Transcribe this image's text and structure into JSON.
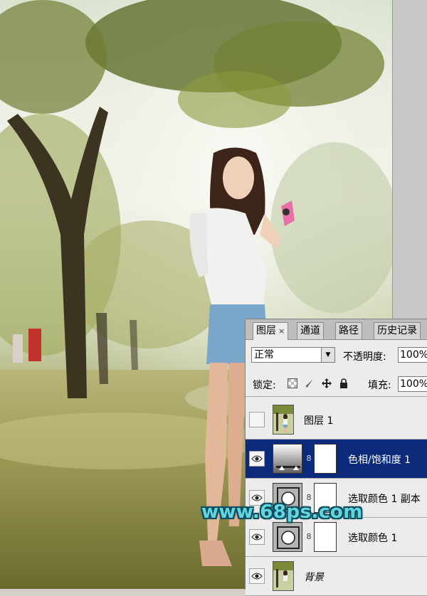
{
  "watermark": "www.68ps.com",
  "panel": {
    "tabs": [
      {
        "label": "图层",
        "close": "×",
        "active": true
      },
      {
        "label": "通道",
        "active": false
      },
      {
        "label": "路径",
        "active": false
      },
      {
        "label": "历史记录",
        "active": false
      }
    ],
    "blend_mode": "正常",
    "opacity_label": "不透明度:",
    "opacity_value": "100%",
    "lock_label": "锁定:",
    "lock_icons": [
      "transparent-pixels-lock-icon",
      "brush-lock-icon",
      "move-lock-icon",
      "padlock-icon"
    ],
    "fill_label": "填充:",
    "fill_value": "100%",
    "layers": [
      {
        "name": "图层 1",
        "visible": false,
        "selected": false,
        "thumb": "photo"
      },
      {
        "name": "色相/饱和度 1",
        "visible": true,
        "selected": true,
        "thumb": "hue-saturation"
      },
      {
        "name": "选取颜色 1 副本",
        "visible": true,
        "selected": false,
        "thumb": "selective-color"
      },
      {
        "name": "选取颜色 1",
        "visible": true,
        "selected": false,
        "thumb": "selective-color"
      },
      {
        "name": "背景",
        "visible": true,
        "selected": false,
        "thumb": "photo",
        "italic": true
      }
    ]
  },
  "colors": {
    "selected_layer": "#0c2a7c",
    "watermark": "#62d6e0",
    "panel_bg": "#ececec"
  }
}
